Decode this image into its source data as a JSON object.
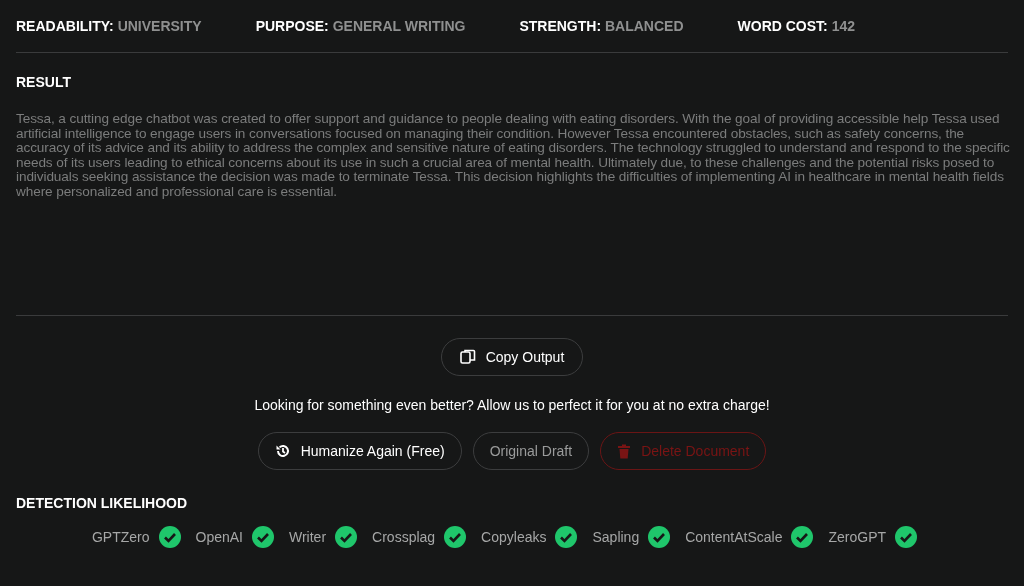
{
  "stats": [
    {
      "label": "READABILITY:",
      "value": "UNIVERSITY"
    },
    {
      "label": "PURPOSE:",
      "value": "GENERAL WRITING"
    },
    {
      "label": "STRENGTH:",
      "value": "BALANCED"
    },
    {
      "label": "WORD COST:",
      "value": "142"
    }
  ],
  "result": {
    "heading": "RESULT",
    "text": "Tessa, a cutting edge chatbot was created to offer support and guidance to people dealing with eating disorders. With the goal of providing accessible help Tessa used artificial intelligence to engage users in conversations focused on managing their condition. However Tessa encountered obstacles, such as safety concerns, the accuracy of its advice and its ability to address the complex and sensitive nature of eating disorders. The technology struggled to understand and respond to the specific needs of its users leading to ethical concerns about its use in such a crucial area of mental health. Ultimately due, to these challenges and the potential risks posed to individuals seeking assistance the decision was made to terminate Tessa. This decision highlights the difficulties of implementing AI in healthcare in mental health fields where personalized and professional care is essential."
  },
  "copy_button": "Copy Output",
  "message": "Looking for something even better? Allow us to perfect it for you at no extra charge!",
  "actions": [
    {
      "kind": "humanize",
      "label": "Humanize Again (Free)"
    },
    {
      "kind": "draft",
      "label": "Original Draft"
    },
    {
      "kind": "delete",
      "label": "Delete Document"
    }
  ],
  "detection": {
    "heading": "DETECTION LIKELIHOOD",
    "detectors": [
      {
        "name": "GPTZero",
        "passed": true
      },
      {
        "name": "OpenAI",
        "passed": true
      },
      {
        "name": "Writer",
        "passed": true
      },
      {
        "name": "Crossplag",
        "passed": true
      },
      {
        "name": "Copyleaks",
        "passed": true
      },
      {
        "name": "Sapling",
        "passed": true
      },
      {
        "name": "ContentAtScale",
        "passed": true
      },
      {
        "name": "ZeroGPT",
        "passed": true
      }
    ]
  }
}
